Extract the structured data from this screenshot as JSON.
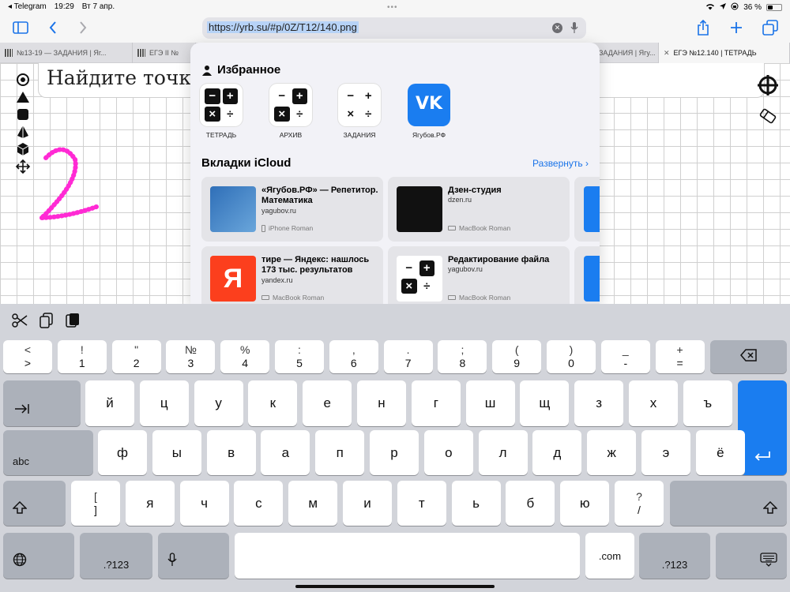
{
  "status": {
    "back_app": "◂ Telegram",
    "time": "19:29",
    "date": "Вт 7 апр.",
    "battery": "36 %",
    "battery_level": 0.36
  },
  "toolbar": {
    "url": "https://yrb.su/#p/0Z/T12/140.png"
  },
  "tabs": [
    {
      "label": "№13-19 — ЗАДАНИЯ | Яг..."
    },
    {
      "label": "ЕГЭ II №"
    },
    {
      "label": "ЗАДАНИЯ | Ягу..."
    },
    {
      "label": "ЕГЭ №12.140 | ТЕТРАДЬ"
    }
  ],
  "page": {
    "task_text": "Найдите точку",
    "handwriting": "2",
    "handwriting_color": "#ff2ad4"
  },
  "favorites": {
    "title": "Избранное",
    "items": [
      {
        "label": "ТЕТРАДЬ",
        "icon": "calculator-icon"
      },
      {
        "label": "АРХИВ",
        "icon": "calculator-icon"
      },
      {
        "label": "ЗАДАНИЯ",
        "icon": "calculator-icon"
      },
      {
        "label": "Ягубов.РФ",
        "icon": "vk-icon"
      }
    ]
  },
  "icloud": {
    "title": "Вкладки iCloud",
    "expand": "Развернуть",
    "cards": [
      {
        "title": "«Ягубов.РФ» — Репетитор. Математика",
        "domain": "yagubov.ru",
        "device": "iPhone Roman"
      },
      {
        "title": "Дзен-студия",
        "domain": "dzen.ru",
        "device": "MacBook Roman"
      },
      {
        "title": "тире — Яндекс: нашлось 173 тыс. результатов",
        "domain": "yandex.ru",
        "device": "MacBook Roman",
        "logo": "Я"
      },
      {
        "title": "Редактирование файла",
        "domain": "yagubov.ru",
        "device": "MacBook Roman"
      }
    ]
  },
  "keyboard": {
    "row1": [
      {
        "top": "<",
        "bottom": ">"
      },
      {
        "top": "!",
        "bottom": "1"
      },
      {
        "top": "\"",
        "bottom": "2"
      },
      {
        "top": "№",
        "bottom": "3"
      },
      {
        "top": "%",
        "bottom": "4"
      },
      {
        "top": ":",
        "bottom": "5"
      },
      {
        "top": ",",
        "bottom": "6"
      },
      {
        "top": ".",
        "bottom": "7"
      },
      {
        "top": ";",
        "bottom": "8"
      },
      {
        "top": "(",
        "bottom": "9"
      },
      {
        "top": ")",
        "bottom": "0"
      },
      {
        "top": "_",
        "bottom": "-"
      },
      {
        "top": "+",
        "bottom": "="
      }
    ],
    "row2": [
      "й",
      "ц",
      "у",
      "к",
      "е",
      "н",
      "г",
      "ш",
      "щ",
      "з",
      "х",
      "ъ"
    ],
    "row3": [
      "ф",
      "ы",
      "в",
      "а",
      "п",
      "р",
      "о",
      "л",
      "д",
      "ж",
      "э",
      "ё"
    ],
    "row4": [
      {
        "top": "[",
        "bottom": "]"
      },
      "я",
      "ч",
      "с",
      "м",
      "и",
      "т",
      "ь",
      "б",
      "ю",
      {
        "top": "?",
        "bottom": "/"
      }
    ],
    "abc": "abc",
    "num_left": ".?123",
    "num_right": ".?123",
    "dotcom": ".com"
  },
  "colors": {
    "accent": "#1a7df0",
    "vk": "#1a7df0",
    "yandex": "#fc3f1d"
  }
}
